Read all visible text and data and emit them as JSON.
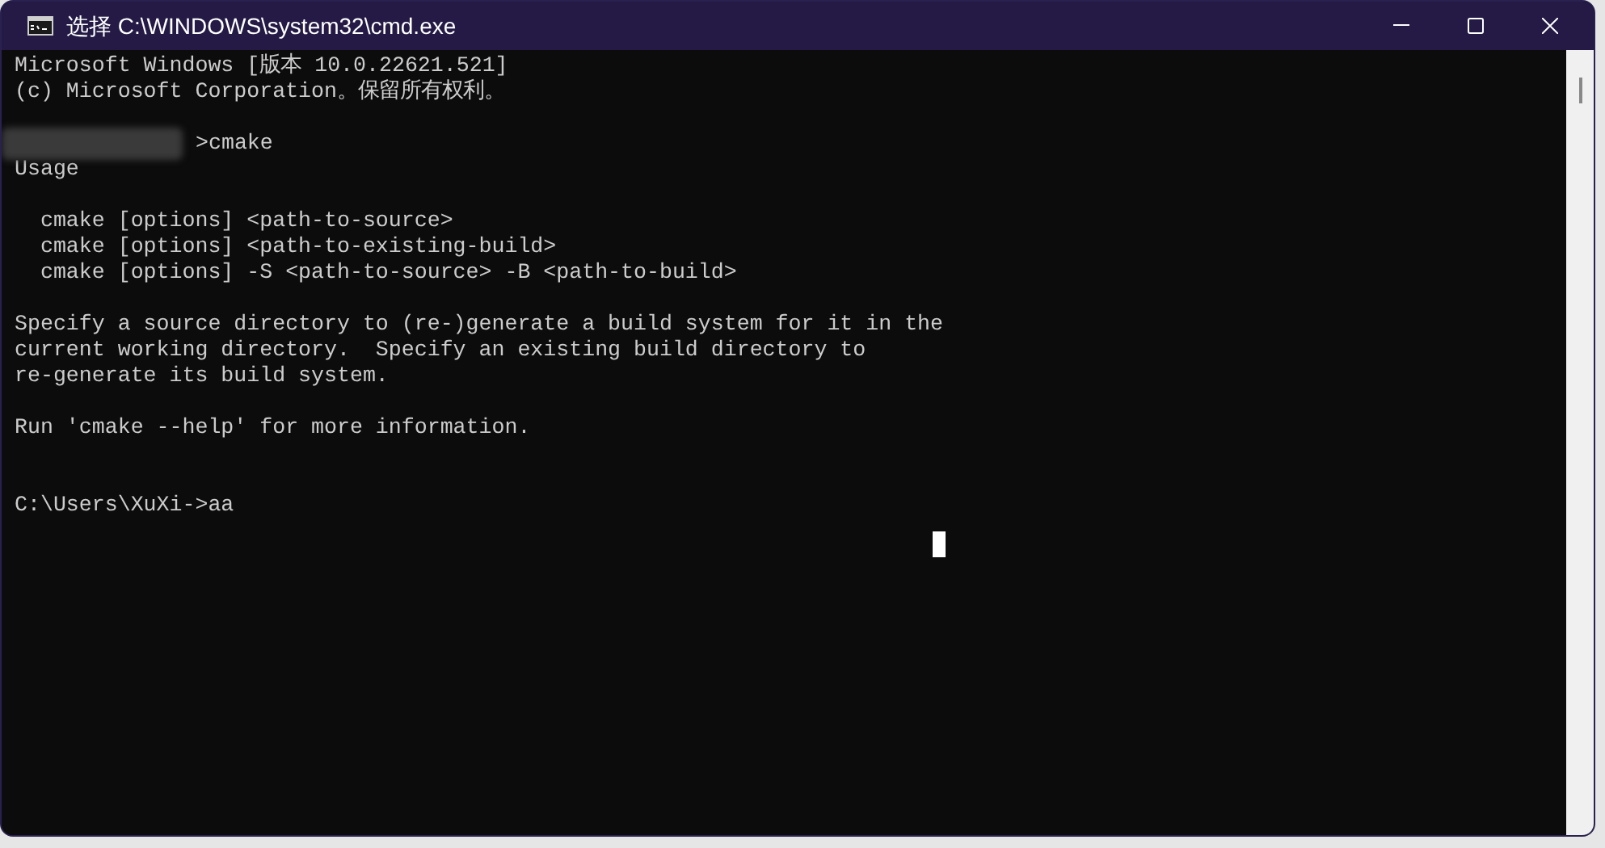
{
  "window": {
    "title": "选择 C:\\WINDOWS\\system32\\cmd.exe"
  },
  "console": {
    "lines": [
      {
        "kind": "text",
        "text": "Microsoft Windows [版本 10.0.22621.521]"
      },
      {
        "kind": "text",
        "text": "(c) Microsoft Corporation。保留所有权利。"
      },
      {
        "kind": "blank"
      },
      {
        "kind": "redacted-prompt",
        "text": ">cmake"
      },
      {
        "kind": "text",
        "text": "Usage"
      },
      {
        "kind": "blank"
      },
      {
        "kind": "text",
        "text": "  cmake [options] <path-to-source>"
      },
      {
        "kind": "text",
        "text": "  cmake [options] <path-to-existing-build>"
      },
      {
        "kind": "text",
        "text": "  cmake [options] -S <path-to-source> -B <path-to-build>"
      },
      {
        "kind": "blank"
      },
      {
        "kind": "text",
        "text": "Specify a source directory to (re-)generate a build system for it in the"
      },
      {
        "kind": "text",
        "text": "current working directory.  Specify an existing build directory to"
      },
      {
        "kind": "text",
        "text": "re-generate its build system."
      },
      {
        "kind": "blank"
      },
      {
        "kind": "text",
        "text": "Run 'cmake --help' for more information."
      },
      {
        "kind": "blank"
      },
      {
        "kind": "blank"
      },
      {
        "kind": "text",
        "text": "C:\\Users\\XuXi->aa"
      }
    ]
  }
}
